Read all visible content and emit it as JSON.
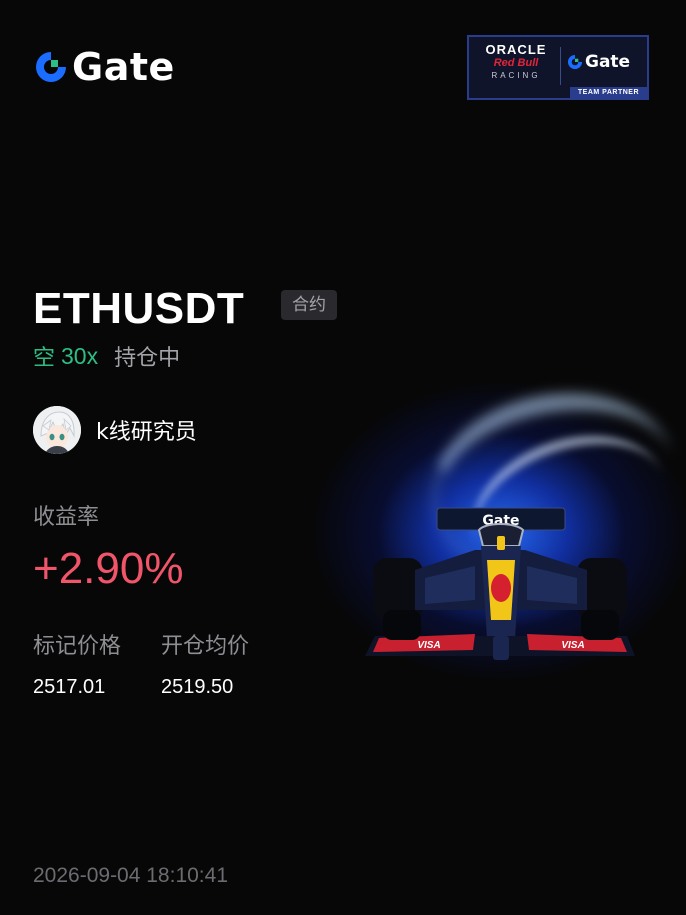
{
  "brand": {
    "logo_text": "Gate",
    "logo_icon": "gate-logo-icon",
    "brand_color": "#1a6dff",
    "accent_green": "#2ebd85"
  },
  "partner_badge": {
    "line1": "ORACLE",
    "line2": "Red Bull",
    "line3": "RACING",
    "partner_logo_text": "Gate",
    "footer": "TEAM PARTNER"
  },
  "position": {
    "pair": "ETHUSDT",
    "type_tag": "合约",
    "side": "空",
    "leverage": "30x",
    "status": "持仓中",
    "side_color": "#2ebd85"
  },
  "user": {
    "name": "k线研究员",
    "avatar_icon": "anime-avatar-icon"
  },
  "pnl": {
    "label": "收益率",
    "value": "+2.90%",
    "color": "#f0556a"
  },
  "prices": {
    "mark_label": "标记价格",
    "mark_value": "2517.01",
    "entry_label": "开仓均价",
    "entry_value": "2519.50"
  },
  "timestamp": "2026-09-04 18:10:41"
}
